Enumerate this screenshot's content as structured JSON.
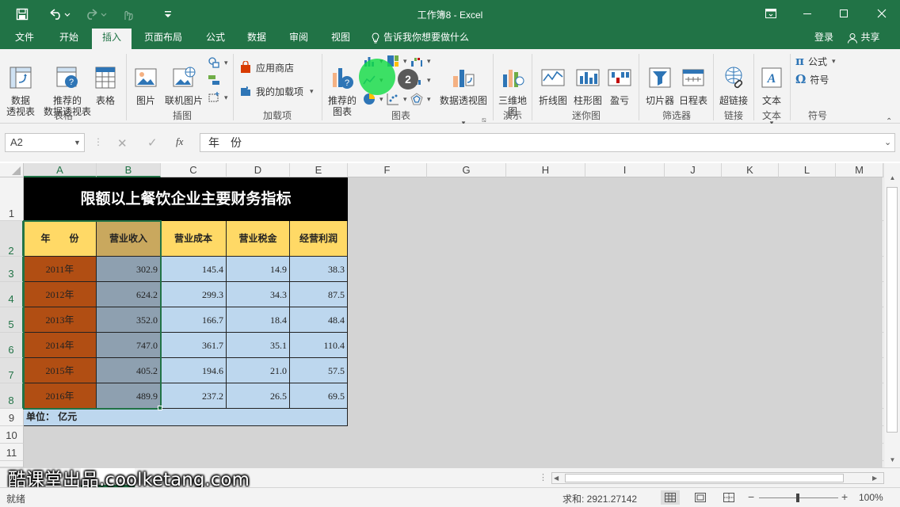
{
  "window": {
    "title": "工作簿8 - Excel",
    "accent": "#217346"
  },
  "qat": {
    "save_icon": "save-icon",
    "undo_icon": "undo-icon",
    "redo_icon": "redo-icon",
    "touch_icon": "touch-mode-icon",
    "customize_icon": "customize-icon"
  },
  "ribbon": {
    "tabs": [
      "文件",
      "开始",
      "插入",
      "页面布局",
      "公式",
      "数据",
      "审阅",
      "视图"
    ],
    "active_tab": "插入",
    "tell_me": "告诉我你想要做什么",
    "login": "登录",
    "share": "共享",
    "groups": {
      "tables": {
        "label": "表格",
        "pivot": "数据\n透视表",
        "rec_pivot": "推荐的\n数据透视表",
        "table": "表格"
      },
      "illus": {
        "label": "插图",
        "picture": "图片",
        "online_picture": "联机图片"
      },
      "addins": {
        "label": "加载项",
        "store": "应用商店",
        "my_addins": "我的加载项"
      },
      "charts": {
        "label": "图表",
        "rec_charts": "推荐的\n图表",
        "pivot_chart": "数据透视图"
      },
      "tours": {
        "label": "演示",
        "map3d": "三维地\n图"
      },
      "spark": {
        "label": "迷你图",
        "line": "折线图",
        "column": "柱形图",
        "winloss": "盈亏"
      },
      "filters": {
        "label": "筛选器",
        "slicer": "切片器",
        "timeline": "日程表"
      },
      "links": {
        "label": "链接",
        "hyperlink": "超链接"
      },
      "text": {
        "label": "文本",
        "text": "文本"
      },
      "symbols": {
        "label": "符号",
        "equation": "公式",
        "symbol": "符号"
      }
    }
  },
  "formula_bar": {
    "name_box": "A2",
    "fx": "fx",
    "content": "年　份"
  },
  "columns": [
    "A",
    "B",
    "C",
    "D",
    "E",
    "F",
    "G",
    "H",
    "I",
    "J",
    "K",
    "L",
    "M"
  ],
  "rows": [
    "1",
    "2",
    "3",
    "4",
    "5",
    "6",
    "7",
    "8",
    "9",
    "10",
    "11"
  ],
  "sheet": {
    "title": "限额以上餐饮企业主要财务指标",
    "headers": [
      "年　　份",
      "营业收入",
      "营业成本",
      "营业税金",
      "经营利润"
    ],
    "data": [
      [
        "2011年",
        "302.9",
        "145.4",
        "14.9",
        "38.3"
      ],
      [
        "2012年",
        "624.2",
        "299.3",
        "34.3",
        "87.5"
      ],
      [
        "2013年",
        "352.0",
        "166.7",
        "18.4",
        "48.4"
      ],
      [
        "2014年",
        "747.0",
        "361.7",
        "35.1",
        "110.4"
      ],
      [
        "2015年",
        "405.2",
        "194.6",
        "21.0",
        "57.5"
      ],
      [
        "2016年",
        "489.9",
        "237.2",
        "26.5",
        "69.5"
      ]
    ],
    "unit": "单位：  亿元"
  },
  "status": {
    "ready": "就绪",
    "sum": "求和: 2921.27142",
    "zoom": "100%"
  },
  "overlay": {
    "step": "2"
  },
  "watermark": "酷课堂出品.coolketang.com"
}
